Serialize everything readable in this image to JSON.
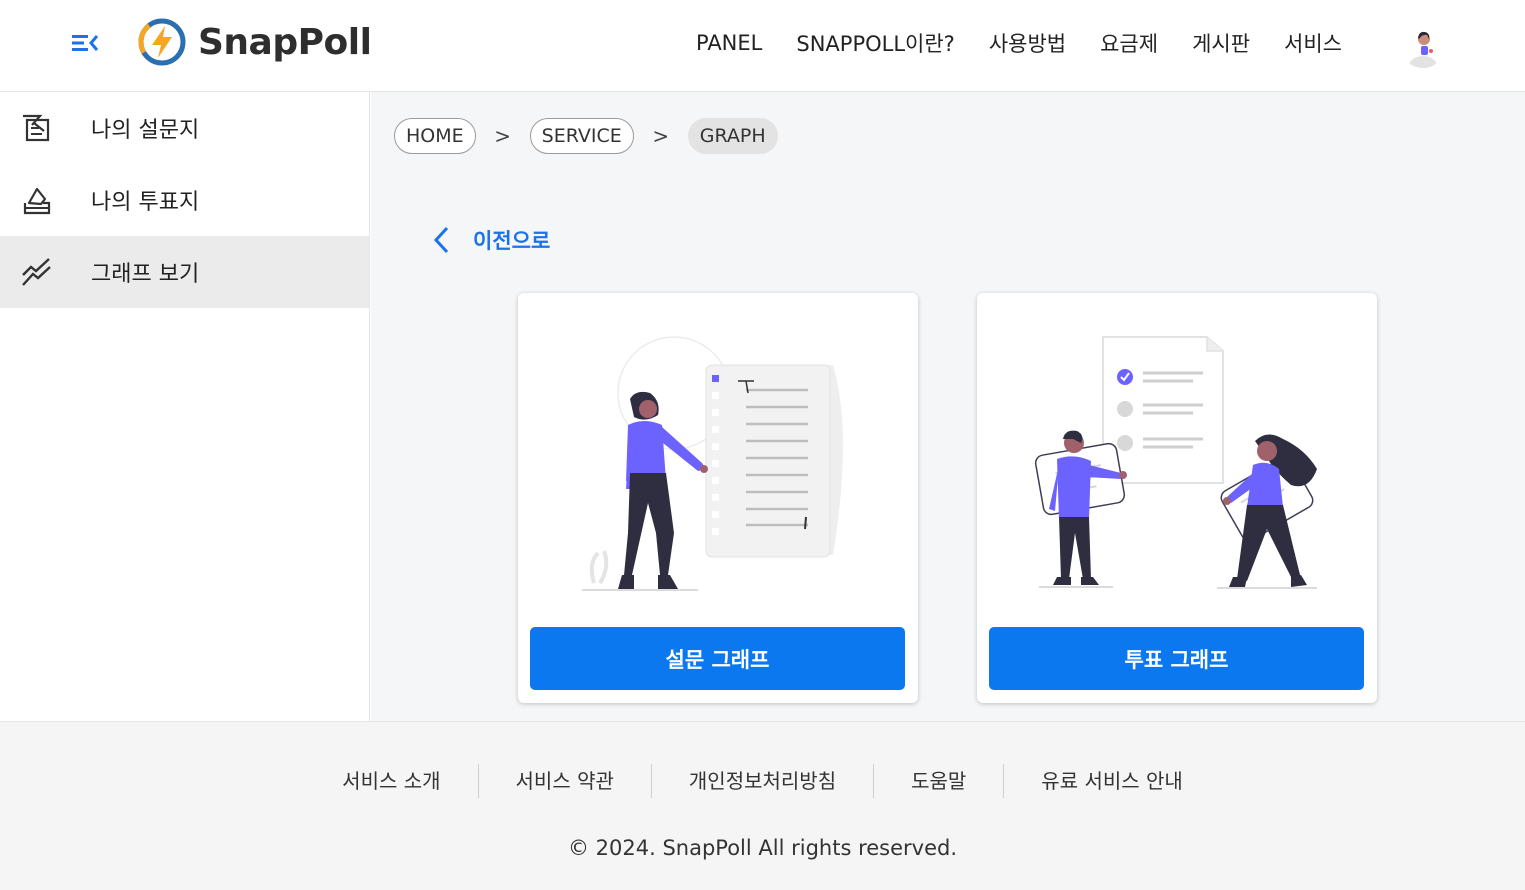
{
  "brand": {
    "name": "SnapPoll",
    "accent": "#0b78f0",
    "logo_icon": "lightning-bolt-icon"
  },
  "nav": {
    "items": [
      "PANEL",
      "SNAPPOLL이란?",
      "사용방법",
      "요금제",
      "게시판",
      "서비스"
    ],
    "avatar_icon": "user-avatar-icon"
  },
  "sidebar": {
    "items": [
      {
        "label": "나의 설문지",
        "icon": "survey-edit-icon",
        "active": false
      },
      {
        "label": "나의 투표지",
        "icon": "ballot-box-icon",
        "active": false
      },
      {
        "label": "그래프 보기",
        "icon": "trend-graph-icon",
        "active": true
      }
    ]
  },
  "breadcrumb": {
    "items": [
      "HOME",
      "SERVICE",
      "GRAPH"
    ],
    "separator": ">"
  },
  "back": {
    "label": "이전으로"
  },
  "cards": [
    {
      "button_label": "설문 그래프",
      "illustration": "survey-illustration"
    },
    {
      "button_label": "투표 그래프",
      "illustration": "vote-illustration"
    }
  ],
  "footer": {
    "links": [
      "서비스 소개",
      "서비스 약관",
      "개인정보처리방침",
      "도움말",
      "유료 서비스 안내"
    ],
    "copyright": "© 2024. SnapPoll All rights reserved."
  }
}
